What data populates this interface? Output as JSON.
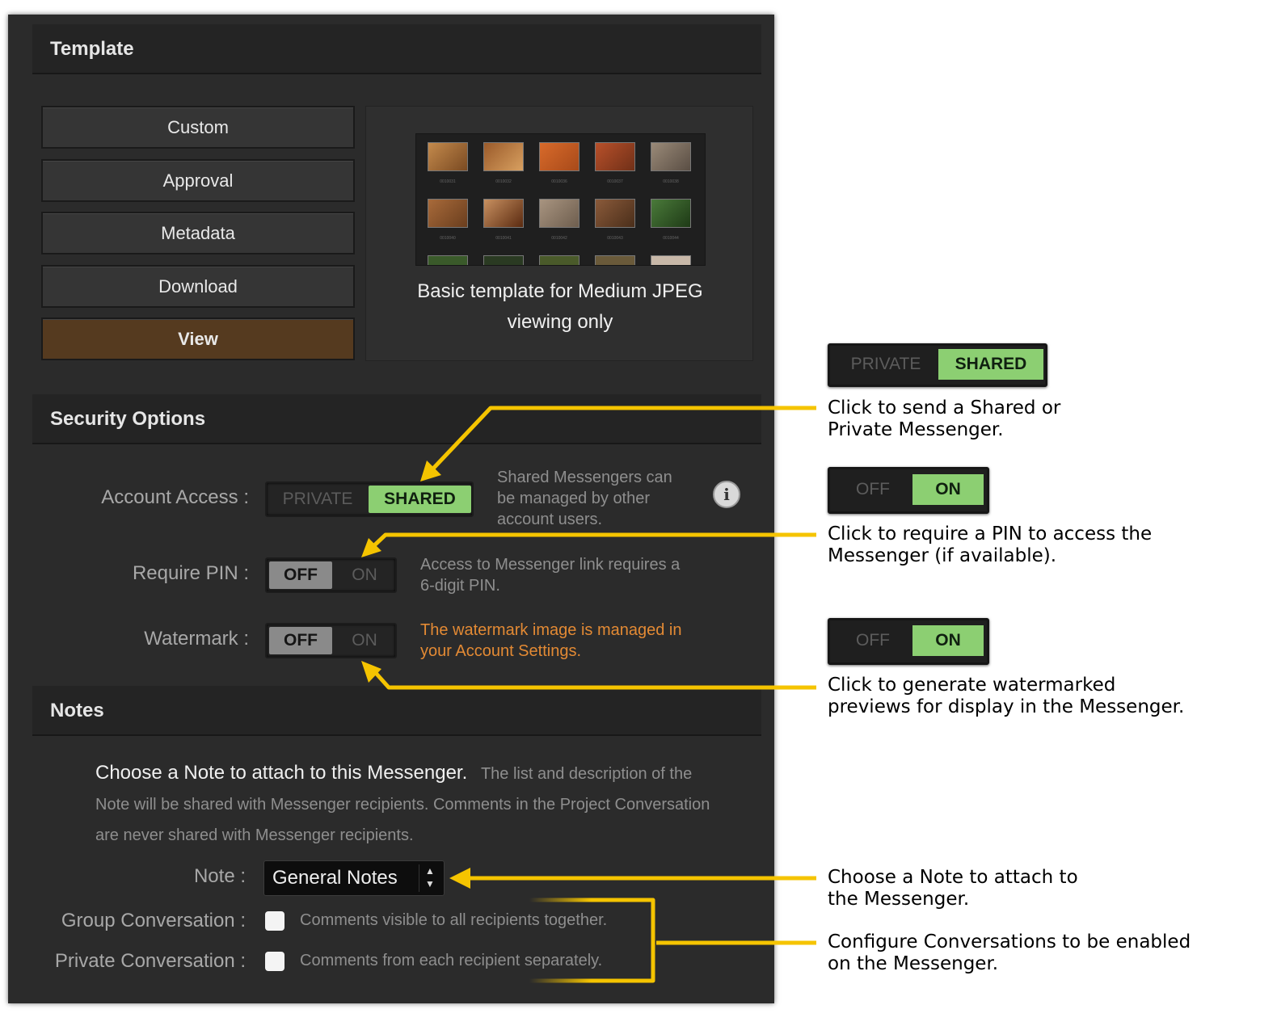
{
  "template": {
    "heading": "Template",
    "buttons": [
      "Custom",
      "Approval",
      "Metadata",
      "Download",
      "View"
    ],
    "active": "View",
    "preview_caption_line1": "Basic template for Medium JPEG",
    "preview_caption_line2": "viewing only",
    "thumb_captions": [
      "0010031",
      "0010032",
      "0010036",
      "0010037",
      "0010038",
      "0010040",
      "0010041",
      "0010042",
      "0010043",
      "0010044"
    ]
  },
  "security": {
    "heading": "Security Options",
    "account_access": {
      "label": "Account Access :",
      "off": "PRIVATE",
      "on": "SHARED",
      "selected": "SHARED",
      "help_line1": "Shared Messengers can",
      "help_line2": "be managed by other",
      "help_line3": "account users."
    },
    "require_pin": {
      "label": "Require PIN :",
      "off": "OFF",
      "on": "ON",
      "selected": "OFF",
      "help_line1": "Access to Messenger link requires a",
      "help_line2": "6-digit PIN."
    },
    "watermark": {
      "label": "Watermark :",
      "off": "OFF",
      "on": "ON",
      "selected": "OFF",
      "help_line1": "The watermark image is managed in",
      "help_line2": "your Account Settings."
    },
    "info_glyph": "i"
  },
  "notes": {
    "heading": "Notes",
    "intro_bold": "Choose a Note to attach to this Messenger.",
    "intro_rest": "The list and description of the",
    "intro_line2": "Note will be shared with Messenger recipients. Comments in the Project Conversation",
    "intro_line3": "are never shared with Messenger recipients.",
    "note_label": "Note :",
    "note_value": "General Notes",
    "group_label": "Group Conversation :",
    "group_help": "Comments visible to all recipients together.",
    "group_checked": false,
    "private_label": "Private Conversation :",
    "private_help": "Comments from each recipient separately.",
    "private_checked": false
  },
  "annotations": {
    "shared_toggle": {
      "off": "PRIVATE",
      "on": "SHARED",
      "line1": "Click to send a Shared or",
      "line2": "Private Messenger."
    },
    "pin_toggle": {
      "off": "OFF",
      "on": "ON",
      "line1": "Click to require a PIN to access the",
      "line2": "Messenger (if available)."
    },
    "watermark_toggle": {
      "off": "OFF",
      "on": "ON",
      "line1": "Click to generate watermarked",
      "line2": "previews for display in the Messenger."
    },
    "note_line1": "Choose a Note to attach to",
    "note_line2": "the Messenger.",
    "conv_line1": "Configure Conversations to be enabled",
    "conv_line2": "on the Messenger."
  },
  "colors": {
    "panel_bg": "#2b2b2b",
    "active_template": "#553a1f",
    "toggle_on": "#8ccf72",
    "watermark_help": "#e38a34",
    "arrow": "#f5c400"
  }
}
